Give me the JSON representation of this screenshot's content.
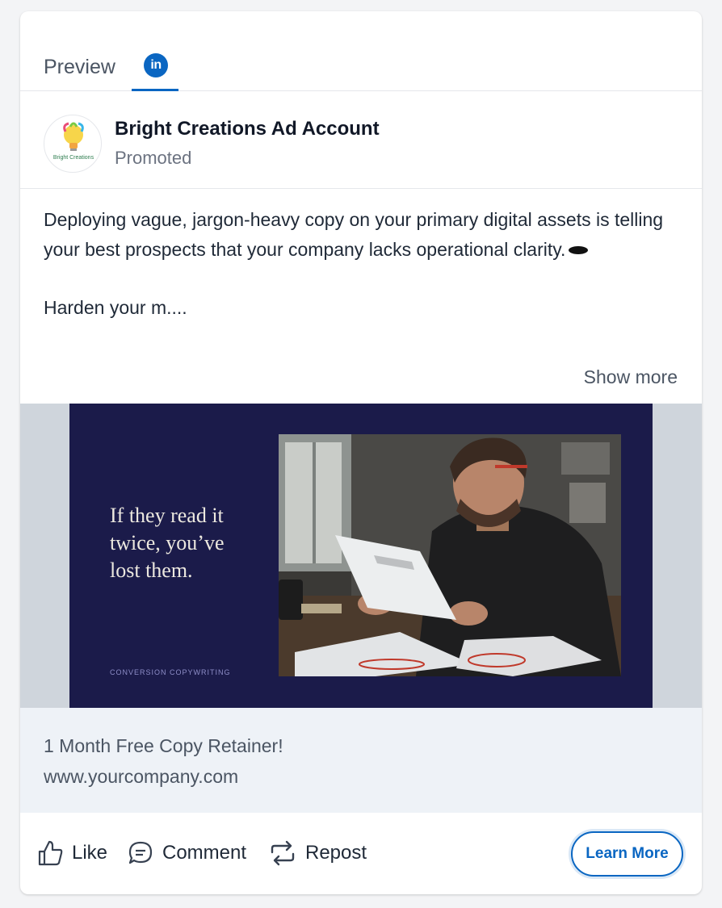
{
  "tabs": {
    "preview_label": "Preview",
    "linkedin_icon_text": "in"
  },
  "post": {
    "account_name": "Bright Creations Ad Account",
    "sponsored_label": "Promoted",
    "avatar_logo_text": "Bright Creations",
    "body_paragraph_1": "Deploying vague, jargon-heavy copy on your primary digital assets is telling your best prospects that your company lacks operational clarity.",
    "body_paragraph_2": "Harden your m....",
    "show_more_label": "Show more"
  },
  "creative": {
    "headline_lines": [
      "If they read it",
      "twice, you’ve",
      "lost them."
    ],
    "tagline": "CONVERSION COPYWRITING"
  },
  "cta": {
    "title": "1 Month Free Copy Retainer!",
    "url": "www.yourcompany.com",
    "button_label": "Learn More"
  },
  "actions": {
    "like_label": "Like",
    "comment_label": "Comment",
    "repost_label": "Repost"
  },
  "colors": {
    "linkedin_blue": "#0a66c2",
    "creative_background": "#1b1b4a",
    "cta_strip_background": "#eef2f7"
  }
}
